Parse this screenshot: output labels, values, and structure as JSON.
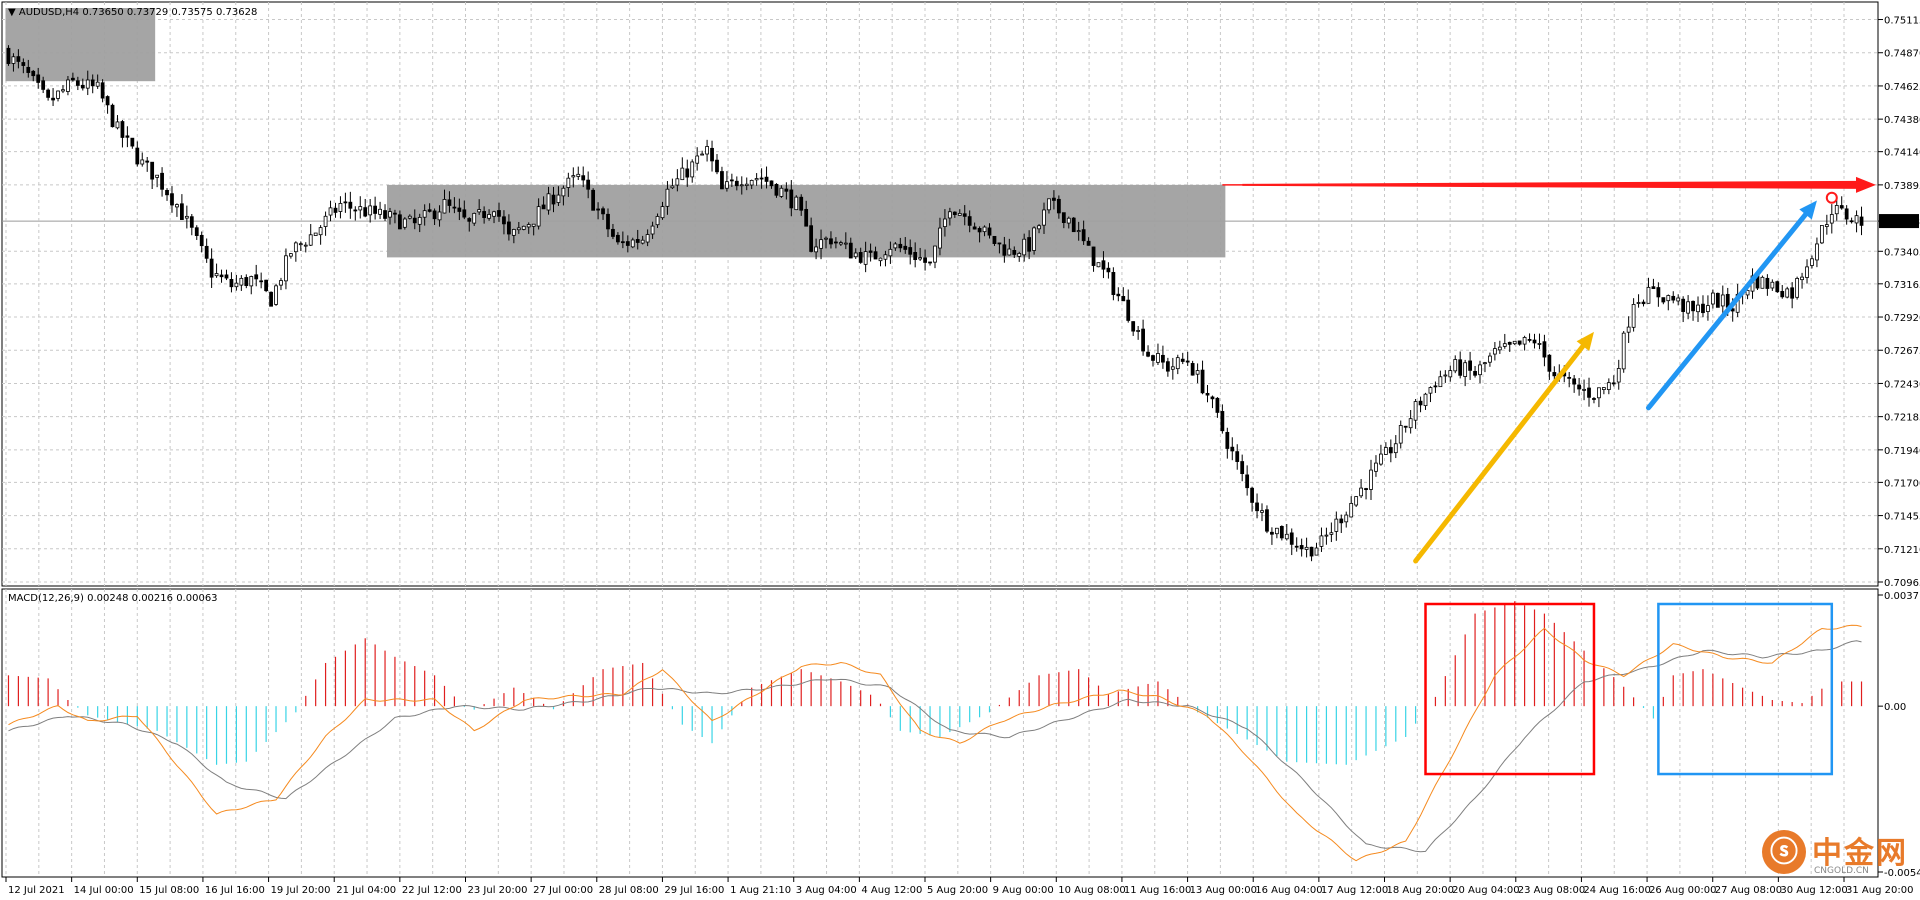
{
  "header": {
    "symbol": "AUDUSD,H4",
    "ohlc": "0.73650 0.73729 0.73575 0.73628"
  },
  "macd_header": "MACD(12,26,9) 0.00248 0.00216 0.00063",
  "current_price_label": "0.73628",
  "watermark": {
    "logo": "中金网",
    "sub": "CNGOLD.CN",
    "glyph": "ⓢ"
  },
  "colors": {
    "bull_fill": "#ffffff",
    "bear_fill": "#000000",
    "grid": "#c8c8c8",
    "zone": "#a0a0a0",
    "red_arrow": "#ff1a1a",
    "yellow_arrow": "#f5b800",
    "blue_arrow": "#2196f3",
    "hist_pos": "#e01f1f",
    "hist_neg": "#39d4e6",
    "macd_line": "#f58a1f",
    "signal_line": "#7f7f7f",
    "red_box": "#ff0000",
    "blue_box": "#2196f3"
  },
  "chart_data": {
    "type": "candlestick",
    "symbol": "AUDUSD",
    "timeframe": "H4",
    "price_axis_ticks": [
      0.75115,
      0.7487,
      0.74625,
      0.7438,
      0.7414,
      0.73895,
      0.73628,
      0.73405,
      0.73165,
      0.7292,
      0.72675,
      0.7243,
      0.72185,
      0.7194,
      0.717,
      0.71455,
      0.7121,
      0.70965
    ],
    "price_axis_ticks_text": [
      "0.75115",
      "0.74870",
      "0.74625",
      "0.74380",
      "0.74140",
      "0.73895",
      "0.73628",
      "0.73405",
      "0.73165",
      "0.72920",
      "0.72675",
      "0.72430",
      "0.72185",
      "0.71940",
      "0.71700",
      "0.71455",
      "0.71210",
      "0.70965"
    ],
    "ylim": [
      0.70965,
      0.752
    ],
    "time_labels": [
      "12 Jul 2021",
      "14 Jul 00:00",
      "15 Jul 08:00",
      "16 Jul 16:00",
      "19 Jul 20:00",
      "21 Jul 04:00",
      "22 Jul 12:00",
      "23 Jul 20:00",
      "27 Jul 00:00",
      "28 Jul 08:00",
      "29 Jul 16:00",
      "1 Aug 21:10",
      "3 Aug 04:00",
      "4 Aug 12:00",
      "5 Aug 20:00",
      "9 Aug 00:00",
      "10 Aug 08:00",
      "11 Aug 16:00",
      "13 Aug 00:00",
      "16 Aug 04:00",
      "17 Aug 12:00",
      "18 Aug 20:00",
      "20 Aug 04:00",
      "23 Aug 08:00",
      "24 Aug 16:00",
      "26 Aug 00:00",
      "27 Aug 08:00",
      "30 Aug 12:00",
      "31 Aug 20:00"
    ],
    "close_path": [
      [
        0,
        0.7485
      ],
      [
        4,
        0.747
      ],
      [
        8,
        0.745
      ],
      [
        13,
        0.7465
      ],
      [
        18,
        0.746
      ],
      [
        22,
        0.743
      ],
      [
        27,
        0.7405
      ],
      [
        30,
        0.7395
      ],
      [
        34,
        0.7375
      ],
      [
        37,
        0.7355
      ],
      [
        41,
        0.7325
      ],
      [
        45,
        0.7315
      ],
      [
        49,
        0.732
      ],
      [
        53,
        0.7305
      ],
      [
        57,
        0.734
      ],
      [
        62,
        0.7355
      ],
      [
        67,
        0.7375
      ],
      [
        72,
        0.737
      ],
      [
        77,
        0.7365
      ],
      [
        82,
        0.736
      ],
      [
        88,
        0.7375
      ],
      [
        93,
        0.736
      ],
      [
        98,
        0.7375
      ],
      [
        101,
        0.735
      ],
      [
        106,
        0.7365
      ],
      [
        111,
        0.7385
      ],
      [
        115,
        0.7395
      ],
      [
        119,
        0.737
      ],
      [
        123,
        0.7345
      ],
      [
        128,
        0.735
      ],
      [
        133,
        0.7385
      ],
      [
        137,
        0.74
      ],
      [
        141,
        0.7415
      ],
      [
        144,
        0.7385
      ],
      [
        148,
        0.7395
      ],
      [
        152,
        0.7395
      ],
      [
        156,
        0.7385
      ],
      [
        159,
        0.7375
      ],
      [
        162,
        0.7345
      ],
      [
        166,
        0.735
      ],
      [
        170,
        0.734
      ],
      [
        174,
        0.7335
      ],
      [
        178,
        0.7345
      ],
      [
        182,
        0.734
      ],
      [
        186,
        0.733
      ],
      [
        190,
        0.7375
      ],
      [
        194,
        0.7365
      ],
      [
        198,
        0.735
      ],
      [
        202,
        0.734
      ],
      [
        206,
        0.7345
      ],
      [
        210,
        0.7375
      ],
      [
        214,
        0.7365
      ],
      [
        218,
        0.734
      ],
      [
        222,
        0.732
      ],
      [
        226,
        0.7295
      ],
      [
        230,
        0.7265
      ],
      [
        234,
        0.7255
      ],
      [
        238,
        0.726
      ],
      [
        242,
        0.7235
      ],
      [
        246,
        0.72
      ],
      [
        250,
        0.7165
      ],
      [
        254,
        0.714
      ],
      [
        258,
        0.713
      ],
      [
        262,
        0.712
      ],
      [
        265,
        0.7125
      ],
      [
        268,
        0.714
      ],
      [
        272,
        0.716
      ],
      [
        276,
        0.718
      ],
      [
        280,
        0.72
      ],
      [
        284,
        0.7225
      ],
      [
        288,
        0.7245
      ],
      [
        292,
        0.7255
      ],
      [
        296,
        0.725
      ],
      [
        300,
        0.7265
      ],
      [
        304,
        0.727
      ],
      [
        308,
        0.7275
      ],
      [
        312,
        0.725
      ],
      [
        316,
        0.724
      ],
      [
        320,
        0.7235
      ],
      [
        324,
        0.7245
      ],
      [
        328,
        0.7305
      ],
      [
        332,
        0.731
      ],
      [
        336,
        0.7305
      ],
      [
        340,
        0.7295
      ],
      [
        344,
        0.7305
      ],
      [
        348,
        0.73
      ],
      [
        352,
        0.732
      ],
      [
        356,
        0.7315
      ],
      [
        360,
        0.731
      ],
      [
        364,
        0.734
      ],
      [
        368,
        0.7372
      ],
      [
        372,
        0.7365
      ],
      [
        374,
        0.7363
      ]
    ],
    "bar_count": 375,
    "zones": [
      {
        "from_bar": 0,
        "to_bar": 29,
        "top": 0.752,
        "bottom": 0.7466
      },
      {
        "from_bar": 77,
        "to_bar": 245,
        "top": 0.73895,
        "bottom": 0.7336
      }
    ],
    "red_arrow": {
      "price": 0.73895,
      "from_bar": 245,
      "to_bar": 375
    },
    "yellow_arrow": {
      "from": [
        284,
        0.7112
      ],
      "to": [
        320,
        0.7281
      ]
    },
    "blue_arrow": {
      "from": [
        331,
        0.7225
      ],
      "to": [
        365,
        0.7378
      ]
    },
    "marker_circle": {
      "bar": 368,
      "price": 0.738
    },
    "macd": {
      "ylim": [
        -0.00544,
        0.0037
      ],
      "ticks_text": [
        "0.0037",
        "0.00",
        "-0.00544"
      ],
      "hist_path": [
        [
          0,
          0.001
        ],
        [
          8,
          0.0009
        ],
        [
          12,
          0.0002
        ],
        [
          16,
          -0.0003
        ],
        [
          30,
          -0.0008
        ],
        [
          42,
          -0.0019
        ],
        [
          48,
          -0.0018
        ],
        [
          58,
          -0.0002
        ],
        [
          64,
          0.0014
        ],
        [
          72,
          0.0022
        ],
        [
          78,
          0.0016
        ],
        [
          86,
          0.001
        ],
        [
          93,
          -0.0002
        ],
        [
          102,
          0.0006
        ],
        [
          110,
          -0.0001
        ],
        [
          120,
          0.0012
        ],
        [
          128,
          0.0014
        ],
        [
          136,
          -0.0006
        ],
        [
          142,
          -0.0012
        ],
        [
          150,
          0.0006
        ],
        [
          160,
          0.0012
        ],
        [
          168,
          0.0008
        ],
        [
          175,
          0.0003
        ],
        [
          180,
          -0.0008
        ],
        [
          188,
          -0.001
        ],
        [
          198,
          -0.0002
        ],
        [
          208,
          0.001
        ],
        [
          216,
          0.0012
        ],
        [
          222,
          0.0004
        ],
        [
          232,
          0.0008
        ],
        [
          240,
          -0.0002
        ],
        [
          248,
          -0.0009
        ],
        [
          258,
          -0.0018
        ],
        [
          270,
          -0.0019
        ],
        [
          282,
          -0.001
        ],
        [
          288,
          0.0003
        ],
        [
          296,
          0.003
        ],
        [
          304,
          0.0034
        ],
        [
          310,
          0.003
        ],
        [
          318,
          0.0018
        ],
        [
          325,
          0.0008
        ],
        [
          332,
          -0.0004
        ],
        [
          336,
          0.001
        ],
        [
          342,
          0.0012
        ],
        [
          350,
          0.0006
        ],
        [
          356,
          0.0002
        ],
        [
          362,
          0.0001
        ],
        [
          368,
          0.0008
        ],
        [
          373,
          0.0008
        ]
      ],
      "macd_path": [
        [
          0,
          -0.0006
        ],
        [
          10,
          0.0
        ],
        [
          16,
          -0.0005
        ],
        [
          26,
          -0.0003
        ],
        [
          32,
          -0.0015
        ],
        [
          42,
          -0.0035
        ],
        [
          54,
          -0.003
        ],
        [
          64,
          -0.001
        ],
        [
          72,
          0.0002
        ],
        [
          86,
          0.0002
        ],
        [
          94,
          -0.0008
        ],
        [
          104,
          0.0002
        ],
        [
          112,
          0.0003
        ],
        [
          124,
          0.0004
        ],
        [
          132,
          0.0012
        ],
        [
          142,
          -0.0005
        ],
        [
          150,
          0.0003
        ],
        [
          160,
          0.0013
        ],
        [
          168,
          0.0014
        ],
        [
          176,
          0.001
        ],
        [
          184,
          -0.0008
        ],
        [
          192,
          -0.0012
        ],
        [
          200,
          -0.0005
        ],
        [
          210,
          0.0
        ],
        [
          224,
          0.0005
        ],
        [
          232,
          0.0003
        ],
        [
          242,
          -0.0003
        ],
        [
          250,
          -0.0016
        ],
        [
          260,
          -0.0035
        ],
        [
          272,
          -0.005
        ],
        [
          282,
          -0.0044
        ],
        [
          290,
          -0.002
        ],
        [
          300,
          0.001
        ],
        [
          310,
          0.0025
        ],
        [
          318,
          0.0015
        ],
        [
          326,
          0.001
        ],
        [
          336,
          0.002
        ],
        [
          346,
          0.0016
        ],
        [
          356,
          0.0014
        ],
        [
          366,
          0.0025
        ],
        [
          373,
          0.0026
        ]
      ],
      "signal_path": [
        [
          0,
          -0.0008
        ],
        [
          12,
          -0.0003
        ],
        [
          24,
          -0.0006
        ],
        [
          34,
          -0.0012
        ],
        [
          44,
          -0.0025
        ],
        [
          56,
          -0.003
        ],
        [
          66,
          -0.0018
        ],
        [
          78,
          -0.0004
        ],
        [
          90,
          0.0
        ],
        [
          104,
          -0.0001
        ],
        [
          118,
          0.0002
        ],
        [
          130,
          0.0006
        ],
        [
          142,
          0.0004
        ],
        [
          154,
          0.0006
        ],
        [
          166,
          0.0009
        ],
        [
          178,
          0.0006
        ],
        [
          190,
          -0.0008
        ],
        [
          202,
          -0.001
        ],
        [
          214,
          -0.0004
        ],
        [
          226,
          0.0002
        ],
        [
          238,
          0.0
        ],
        [
          250,
          -0.0007
        ],
        [
          262,
          -0.0025
        ],
        [
          274,
          -0.0045
        ],
        [
          286,
          -0.0047
        ],
        [
          296,
          -0.003
        ],
        [
          306,
          -0.001
        ],
        [
          318,
          0.0008
        ],
        [
          330,
          0.0012
        ],
        [
          342,
          0.0018
        ],
        [
          354,
          0.0016
        ],
        [
          366,
          0.0018
        ],
        [
          373,
          0.0021
        ]
      ],
      "red_box": {
        "from_bar": 286,
        "to_bar": 320,
        "top": 0.0037,
        "bottom": -0.0022
      },
      "blue_box": {
        "from_bar": 333,
        "to_bar": 368,
        "top": 0.0037,
        "bottom": -0.0022
      }
    }
  }
}
